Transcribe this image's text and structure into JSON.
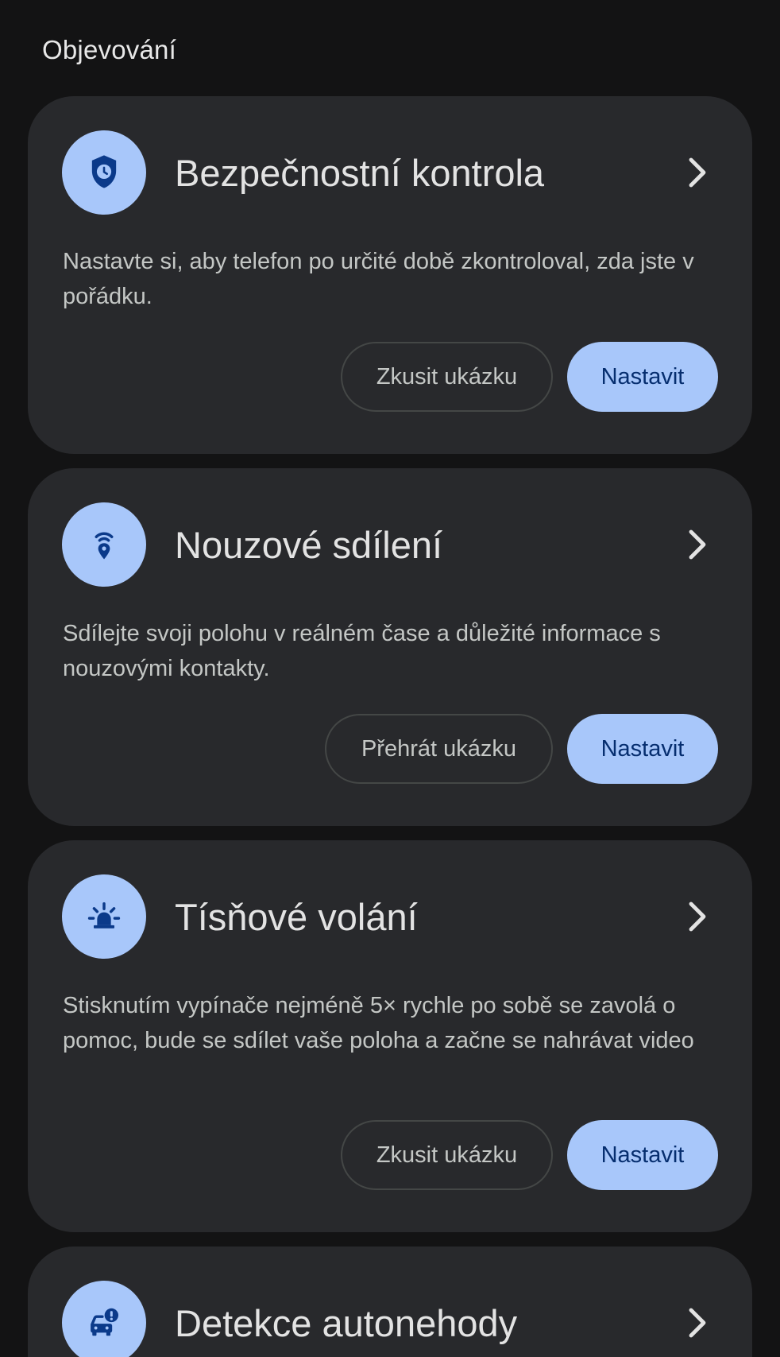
{
  "section": {
    "title": "Objevování"
  },
  "cards": [
    {
      "icon": "shield-clock-icon",
      "title": "Bezpečnostní kontrola",
      "description": "Nastavte si, aby telefon po určité době zkontroloval, zda jste v pořádku.",
      "secondary_label": "Zkusit ukázku",
      "primary_label": "Nastavit"
    },
    {
      "icon": "location-broadcast-icon",
      "title": "Nouzové sdílení",
      "description": "Sdílejte svoji polohu v reálném čase a důležité informace s nouzovými kontakty.",
      "secondary_label": "Přehrát ukázku",
      "primary_label": "Nastavit"
    },
    {
      "icon": "emergency-siren-icon",
      "title": "Tísňové volání",
      "description": "Stisknutím vypínače nejméně 5× rychle po sobě se zavolá o pomoc, bude se sdílet vaše poloha a začne se nahrávat video",
      "secondary_label": "Zkusit ukázku",
      "primary_label": "Nastavit"
    },
    {
      "icon": "car-crash-icon",
      "title": "Detekce autonehody"
    }
  ],
  "colors": {
    "background": "#131314",
    "card": "#28292c",
    "accent": "#a8c7fa",
    "on_accent": "#062e6f"
  }
}
